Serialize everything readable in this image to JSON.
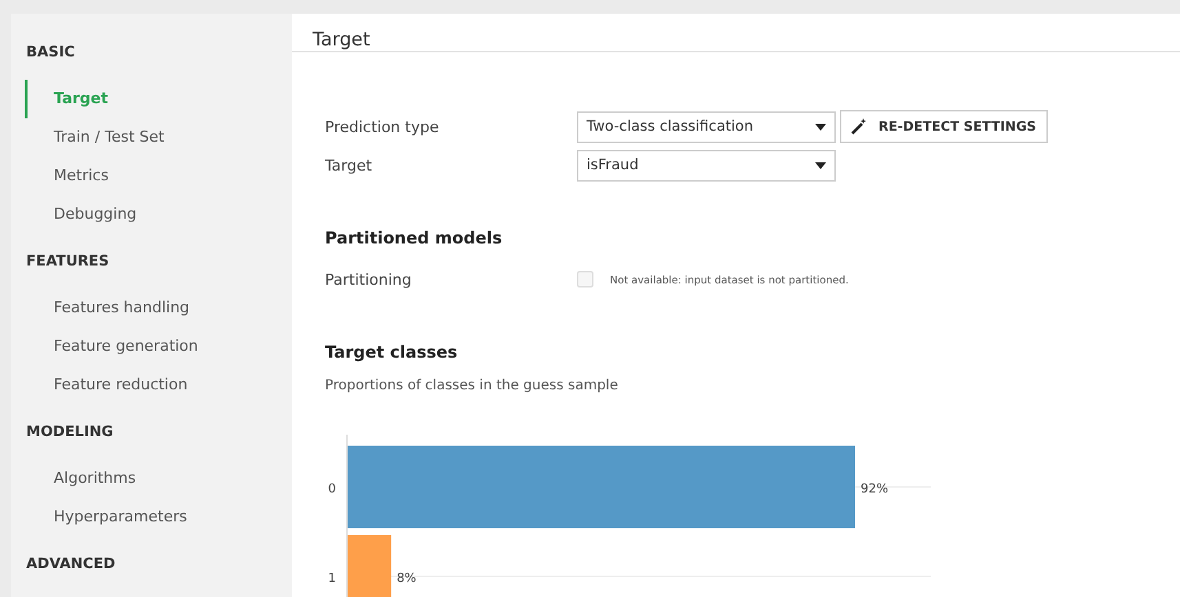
{
  "sidebar": {
    "sections": [
      {
        "title": "BASIC",
        "items": [
          {
            "label": "Target",
            "selected": true
          },
          {
            "label": "Train / Test Set",
            "selected": false
          },
          {
            "label": "Metrics",
            "selected": false
          },
          {
            "label": "Debugging",
            "selected": false
          }
        ]
      },
      {
        "title": "FEATURES",
        "items": [
          {
            "label": "Features handling",
            "selected": false
          },
          {
            "label": "Feature generation",
            "selected": false
          },
          {
            "label": "Feature reduction",
            "selected": false
          }
        ]
      },
      {
        "title": "MODELING",
        "items": [
          {
            "label": "Algorithms",
            "selected": false
          },
          {
            "label": "Hyperparameters",
            "selected": false
          }
        ]
      },
      {
        "title": "ADVANCED"
      }
    ]
  },
  "header": {
    "title": "Target"
  },
  "form": {
    "rows": [
      {
        "label": "Prediction type",
        "value": "Two-class classification",
        "button": "RE-DETECT SETTINGS"
      },
      {
        "label": "Target",
        "value": "isFraud"
      }
    ]
  },
  "partitioned": {
    "title": "Partitioned models",
    "label": "Partitioning",
    "checked": false,
    "disabled": true,
    "note": "Not available: input dataset is not partitioned."
  },
  "target_classes": {
    "title": "Target classes",
    "subtitle": "Proportions of classes in the guess sample",
    "chart_data": {
      "type": "bar",
      "orientation": "horizontal",
      "categories": [
        "0",
        "1"
      ],
      "value_labels": [
        "92%",
        "8%"
      ],
      "values": [
        92,
        8
      ],
      "colors": [
        "#5599c7",
        "#fe9f4a"
      ]
    }
  }
}
